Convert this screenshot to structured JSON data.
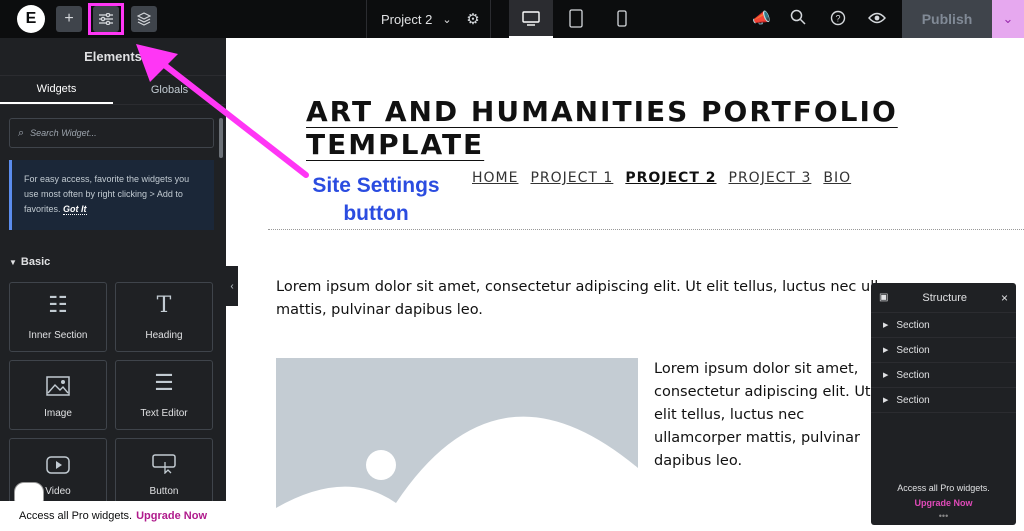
{
  "topbar": {
    "logo": "E",
    "project_name": "Project 2",
    "publish_label": "Publish"
  },
  "sidebar": {
    "title": "Elements",
    "tabs": [
      "Widgets",
      "Globals"
    ],
    "search_placeholder": "Search Widget...",
    "tip_text": "For easy access, favorite the widgets you use most often by right clicking > Add to favorites.",
    "tip_link": "Got It",
    "section_label": "Basic",
    "widgets": [
      "Inner Section",
      "Heading",
      "Image",
      "Text Editor",
      "Video",
      "Button"
    ],
    "promo_text": "Access all Pro widgets.",
    "promo_link": "Upgrade Now"
  },
  "canvas": {
    "site_title": "ART AND HUMANITIES PORTFOLIO TEMPLATE",
    "nav": [
      "HOME",
      "PROJECT 1",
      "PROJECT 2",
      "PROJECT 3",
      "BIO"
    ],
    "para1": "Lorem ipsum dolor sit amet, consectetur adipiscing elit. Ut elit tellus, luctus nec ullamcorper mattis, pulvinar dapibus leo.",
    "para2": "Lorem ipsum dolor sit amet, consectetur adipiscing elit. Ut elit tellus, luctus nec ullamcorper mattis, pulvinar dapibus leo."
  },
  "annotation": {
    "line1": "Site Settings",
    "line2": "button",
    "color": "#ff36f5"
  },
  "structure": {
    "title": "Structure",
    "items": [
      "Section",
      "Section",
      "Section",
      "Section"
    ],
    "promo_text": "Access all Pro widgets.",
    "promo_link": "Upgrade Now"
  }
}
